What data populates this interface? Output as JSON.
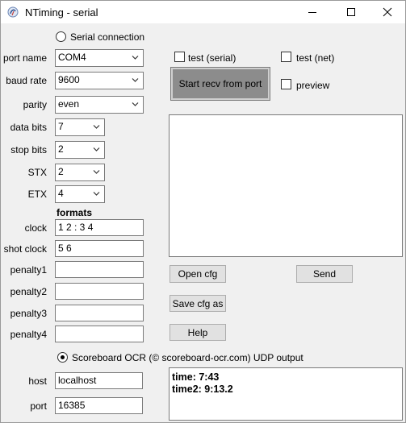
{
  "window": {
    "title": "NTiming - serial",
    "icons": {
      "app": "ntiming-app-icon",
      "minimize": "minimize-icon",
      "maximize": "maximize-icon",
      "close": "close-icon"
    }
  },
  "serial": {
    "radio_label": "Serial connection",
    "radio_selected": false,
    "port_name": {
      "label": "port name",
      "value": "COM4"
    },
    "baud_rate": {
      "label": "baud rate",
      "value": "9600"
    },
    "parity": {
      "label": "parity",
      "value": "even"
    },
    "data_bits": {
      "label": "data bits",
      "value": "7"
    },
    "stop_bits": {
      "label": "stop bits",
      "value": "2"
    },
    "stx": {
      "label": "STX",
      "value": "2"
    },
    "etx": {
      "label": "ETX",
      "value": "4"
    }
  },
  "formats": {
    "heading": "formats",
    "clock": {
      "label": "clock",
      "value": "1 2 : 3 4"
    },
    "shot_clock": {
      "label": "shot clock",
      "value": "5 6"
    },
    "penalty1": {
      "label": "penalty1",
      "value": ""
    },
    "penalty2": {
      "label": "penalty2",
      "value": ""
    },
    "penalty3": {
      "label": "penalty3",
      "value": ""
    },
    "penalty4": {
      "label": "penalty4",
      "value": ""
    }
  },
  "options": {
    "test_serial": {
      "label": "test (serial)",
      "checked": false
    },
    "test_net": {
      "label": "test (net)",
      "checked": false
    },
    "preview": {
      "label": "preview",
      "checked": false
    }
  },
  "buttons": {
    "start_recv": "Start recv from port",
    "open_cfg": "Open cfg",
    "send": "Send",
    "save_cfg_as": "Save cfg as",
    "help": "Help"
  },
  "udp": {
    "radio_label": "Scoreboard OCR (© scoreboard-ocr.com) UDP output",
    "radio_selected": true,
    "host": {
      "label": "host",
      "value": "localhost"
    },
    "port": {
      "label": "port",
      "value": "16385"
    }
  },
  "output": {
    "lines": [
      "time: 7:43",
      "time2: 9:13.2"
    ]
  },
  "colors": {
    "window_bg": "#f0f0f0",
    "titlebar_bg": "#ffffff",
    "button_bg": "#e1e1e1",
    "start_button_bg": "#8c8c8c"
  }
}
